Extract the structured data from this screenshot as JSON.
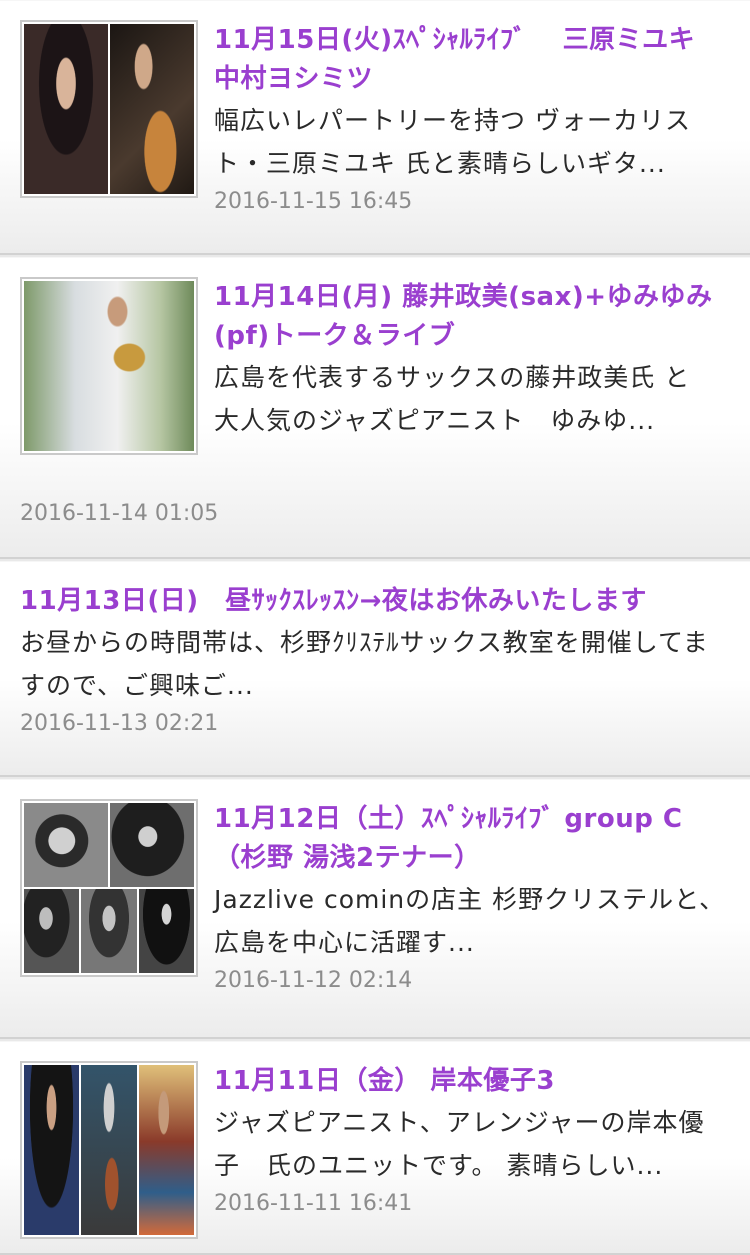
{
  "posts": [
    {
      "title": "11月15日(火)ｽﾍﾟｼｬﾙﾗｲﾌﾞ　 三原ミユキ　中村ヨシミツ",
      "excerpt": "幅広いレパートリーを持つ ヴォーカリスト・三原ミユキ 氏と素晴らしいギタ...",
      "date": "2016-11-15 16:45",
      "has_image": true
    },
    {
      "title": "11月14日(月) 藤井政美(sax)+ゆみゆみ(pf)トーク＆ライブ",
      "excerpt": "広島を代表するサックスの藤井政美氏 と　大人気のジャズピアニスト　ゆみゆ...",
      "date": "2016-11-14 01:05",
      "has_image": true
    },
    {
      "title": "11月13日(日)　昼ｻｯｸｽﾚｯｽﾝ→夜はお休みいたします",
      "excerpt": "お昼からの時間帯は、杉野ｸﾘｽﾃﾙサックス教室を開催してますので、ご興味ご...",
      "date": "2016-11-13 02:21",
      "has_image": false
    },
    {
      "title": "11月12日（土）ｽﾍﾟｼｬﾙﾗｲﾌﾞ group C（杉野 湯浅2テナー）",
      "excerpt": "Jazzlive cominの店主 杉野クリステルと、広島を中心に活躍す...",
      "date": "2016-11-12 02:14",
      "has_image": true
    },
    {
      "title": "11月11日（金） 岸本優子3",
      "excerpt": "ジャズピアニスト、アレンジャーの岸本優子　氏のユニットです。 素晴らしい...",
      "date": "2016-11-11 16:41",
      "has_image": true
    }
  ],
  "colors": {
    "title": "#9a3fcf",
    "text": "#2a2a2a",
    "date": "#8c8c8c",
    "background": "#e9e9e9"
  }
}
